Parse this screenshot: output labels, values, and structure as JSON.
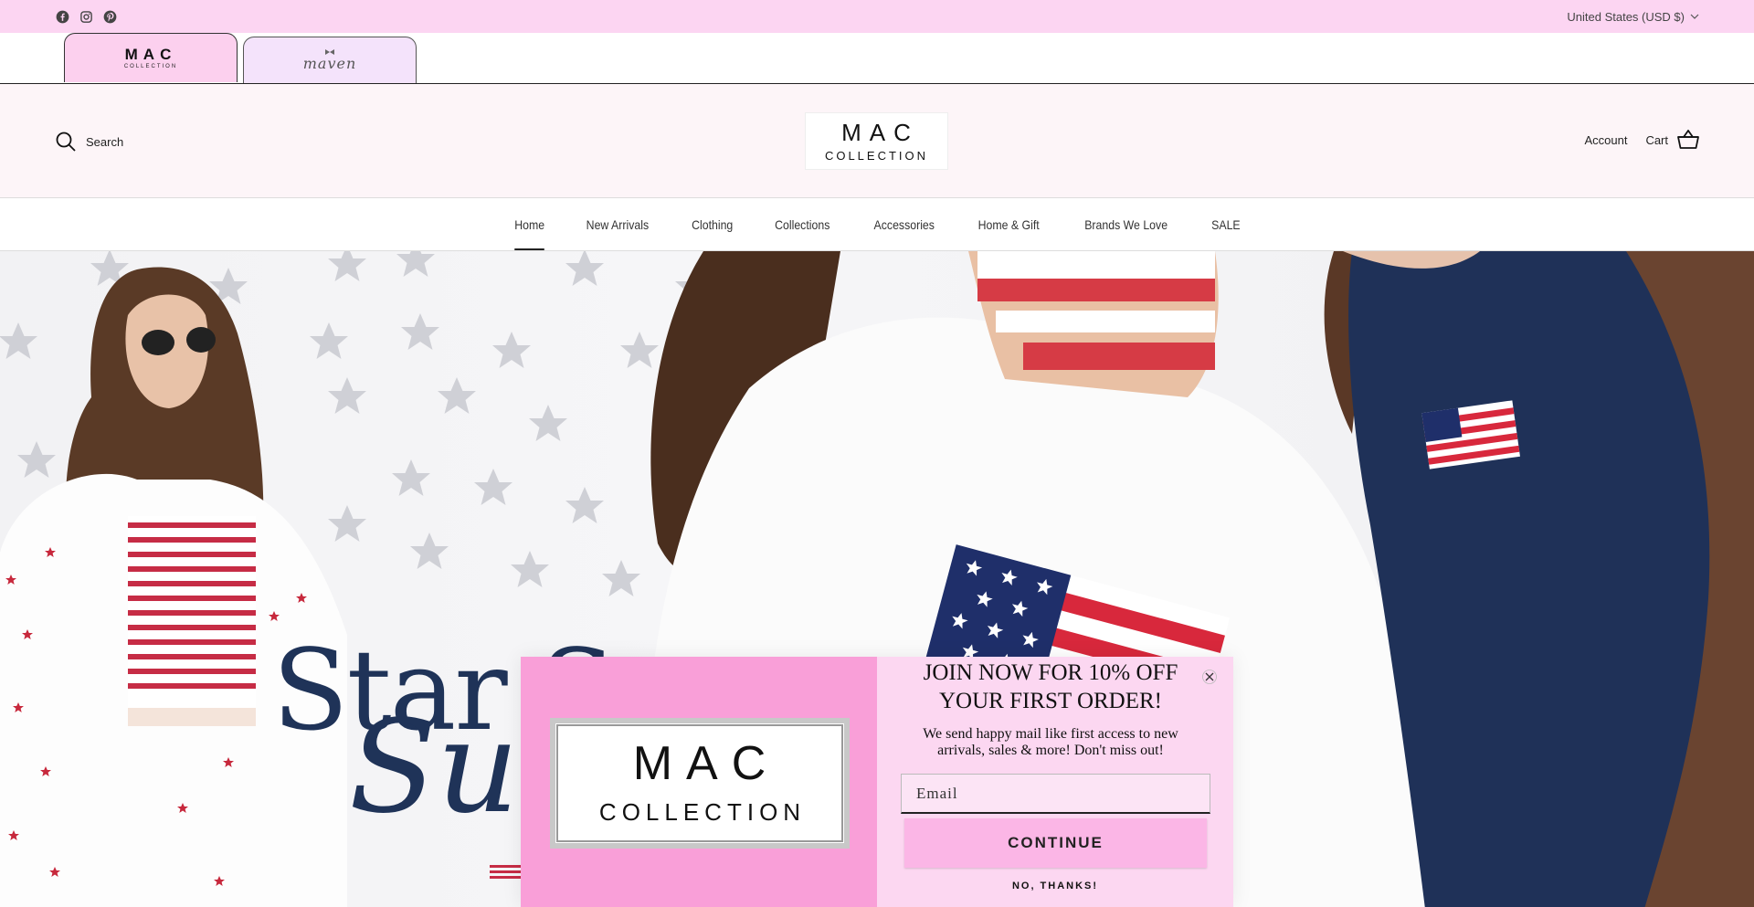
{
  "topbar": {
    "social_icons": [
      "facebook-icon",
      "instagram-icon",
      "pinterest-icon"
    ],
    "currency": "United States (USD $)",
    "background": "#fcd5f2"
  },
  "store_tabs": [
    {
      "main": "MAC",
      "sub": "COLLECTION",
      "active": true
    },
    {
      "main": "maven",
      "active": false
    }
  ],
  "header": {
    "search_label": "Search",
    "logo_main": "MAC",
    "logo_sub": "COLLECTION",
    "account_label": "Account",
    "cart_label": "Cart"
  },
  "nav": {
    "items": [
      "Home",
      "New Arrivals",
      "Clothing",
      "Collections",
      "Accessories",
      "Home & Gift",
      "Brands We Love",
      "SALE"
    ],
    "active": "Home"
  },
  "hero": {
    "title_line1": "Star S",
    "title_line2": "Su"
  },
  "popup": {
    "logo_main": "MAC",
    "logo_sub": "COLLECTION",
    "heading": "JOIN NOW FOR 10% OFF YOUR FIRST ORDER!",
    "body": "We send happy mail like first access to new arrivals, sales & more! Don't miss out!",
    "email_placeholder": "Email",
    "continue_label": "CONTINUE",
    "no_thanks_label": "NO, THANKS!",
    "accent_left": "#f99fd8",
    "accent_right": "#fcd7f1"
  }
}
